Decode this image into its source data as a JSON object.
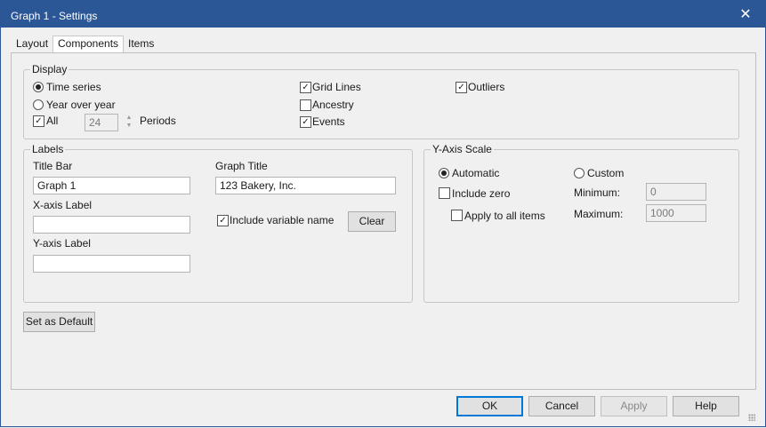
{
  "window": {
    "title": "Graph 1 - Settings"
  },
  "tabs": {
    "layout": "Layout",
    "components": "Components",
    "items": "Items"
  },
  "display": {
    "legend": "Display",
    "time_series": "Time series",
    "year_over_year": "Year over year",
    "all": "All",
    "periods_value": "24",
    "periods_label": "Periods",
    "grid_lines": "Grid Lines",
    "ancestry": "Ancestry",
    "events": "Events",
    "outliers": "Outliers"
  },
  "labels": {
    "legend": "Labels",
    "title_bar_label": "Title Bar",
    "title_bar_value": "Graph 1",
    "graph_title_label": "Graph Title",
    "graph_title_value": "123 Bakery, Inc.",
    "x_axis_label": "X-axis Label",
    "x_axis_value": "",
    "y_axis_label": "Y-axis Label",
    "y_axis_value": "",
    "include_variable_name": "Include variable name",
    "clear": "Clear"
  },
  "y_axis_scale": {
    "legend": "Y-Axis Scale",
    "automatic": "Automatic",
    "custom": "Custom",
    "include_zero": "Include zero",
    "apply_to_all": "Apply to all items",
    "minimum_label": "Minimum:",
    "minimum_value": "0",
    "maximum_label": "Maximum:",
    "maximum_value": "1000"
  },
  "set_as_default": "Set as Default",
  "footer": {
    "ok": "OK",
    "cancel": "Cancel",
    "apply": "Apply",
    "help": "Help"
  },
  "colors": {
    "titlebar": "#2b5797",
    "accent": "#0078d7"
  }
}
